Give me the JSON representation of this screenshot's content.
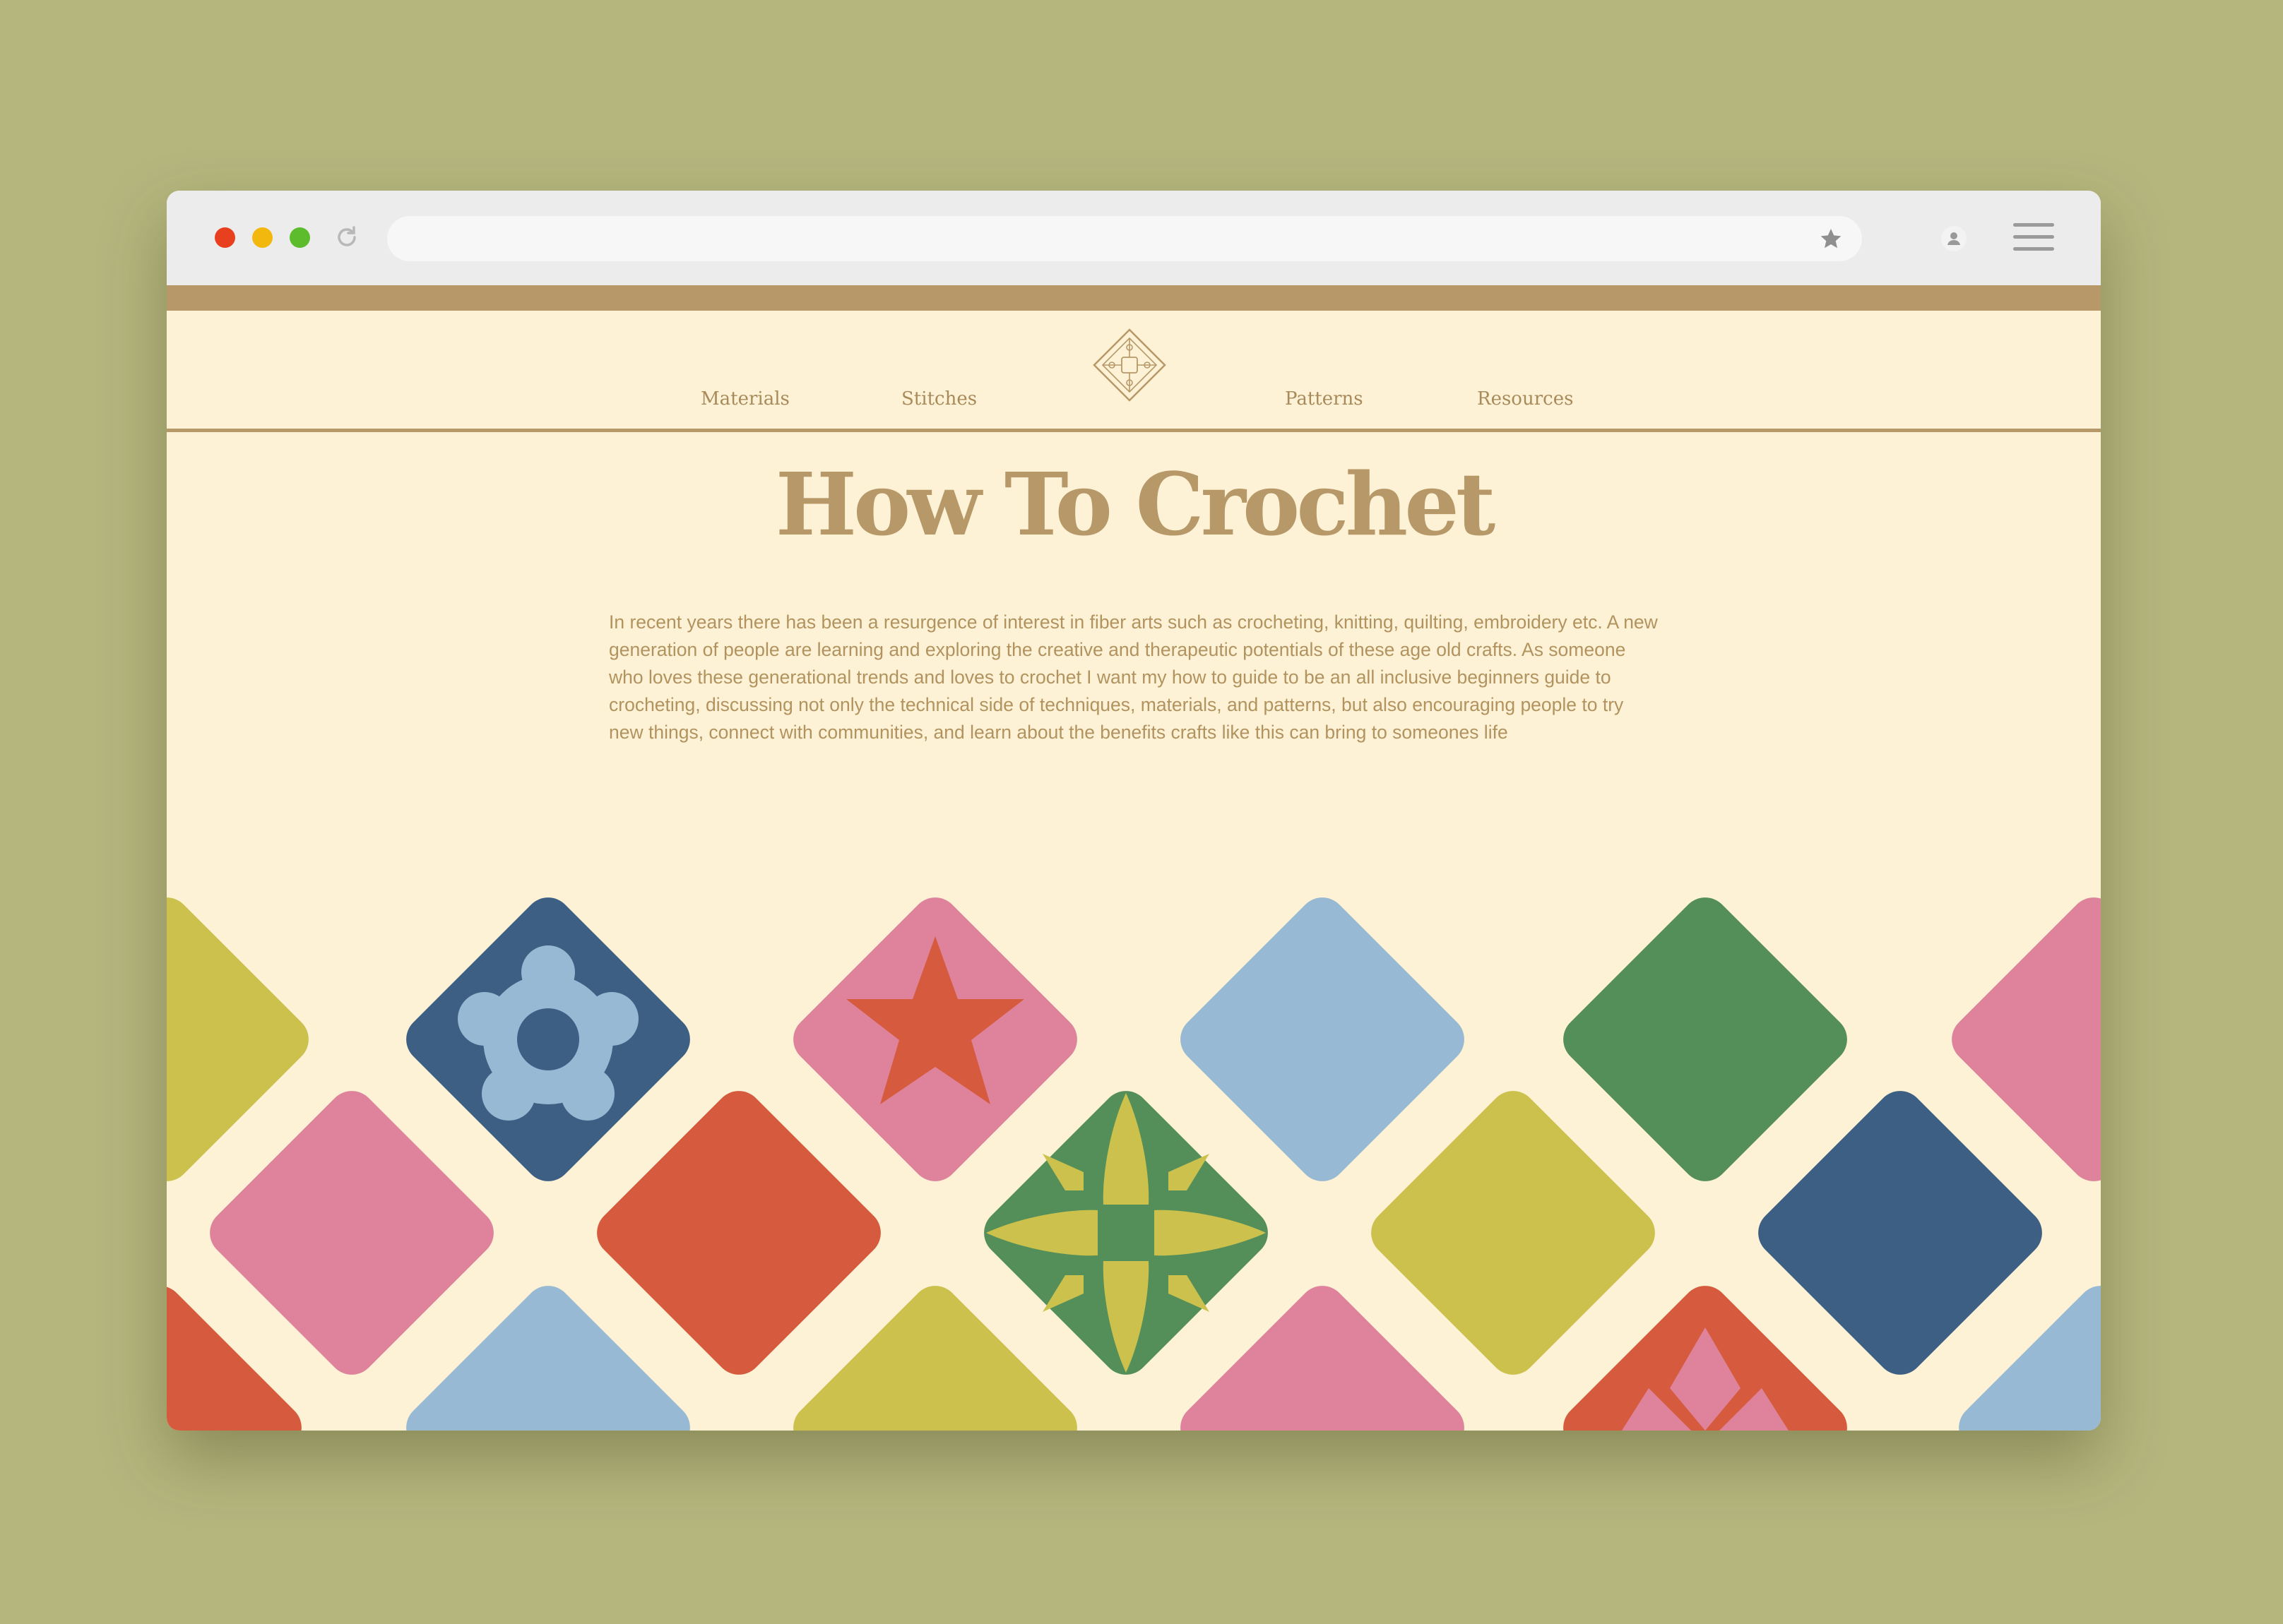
{
  "browser": {
    "window_controls": [
      "close",
      "minimize",
      "maximize"
    ],
    "reload_icon": "reload-icon",
    "address_bar_value": "",
    "bookmark_icon": "star-icon",
    "profile_icon": "user-icon",
    "menu_icon": "hamburger-menu-icon"
  },
  "site": {
    "nav": {
      "items": [
        "Materials",
        "Stitches",
        "Patterns",
        "Resources"
      ],
      "logo_icon": "crochet-granny-square-logo"
    },
    "title": "How To Crochet",
    "intro": "In recent years there has been a resurgence of interest in fiber arts such as crocheting, knitting, quilting, embroidery etc. A new generation of people are learning and exploring the creative and therapeutic potentials of these age old crafts. As someone who loves these generational trends and loves to crochet I want my how to guide to be an all inclusive beginners guide to crocheting, discussing not only the technical side of techniques, materials, and patterns, but also encouraging people to try new things, connect with communities, and learn about the benefits crafts like this can bring to someones life"
  },
  "colors": {
    "backdrop": "#b5b67e",
    "page_bg": "#fdf2d5",
    "accent_tan": "#b79868",
    "tile_yellow": "#cbc14c",
    "tile_pink": "#de839b",
    "tile_navy": "#3d5f84",
    "tile_red": "#d65b3e",
    "tile_lightblue": "#97b9d3",
    "tile_green": "#548f5a"
  },
  "tiles": [
    {
      "color": "tile_yellow",
      "motif": "none"
    },
    {
      "color": "tile_navy",
      "motif": "flower"
    },
    {
      "color": "tile_pink",
      "motif": "star"
    },
    {
      "color": "tile_lightblue",
      "motif": "none"
    },
    {
      "color": "tile_green",
      "motif": "none"
    },
    {
      "color": "tile_pink",
      "motif": "none"
    },
    {
      "color": "tile_pink",
      "motif": "none"
    },
    {
      "color": "tile_red",
      "motif": "none"
    },
    {
      "color": "tile_green",
      "motif": "compass-star"
    },
    {
      "color": "tile_yellow",
      "motif": "none"
    },
    {
      "color": "tile_navy",
      "motif": "none"
    },
    {
      "color": "tile_red",
      "motif": "none"
    },
    {
      "color": "tile_lightblue",
      "motif": "none"
    },
    {
      "color": "tile_yellow",
      "motif": "none"
    },
    {
      "color": "tile_pink",
      "motif": "none"
    },
    {
      "color": "tile_red",
      "motif": "geometric"
    },
    {
      "color": "tile_lightblue",
      "motif": "none"
    }
  ]
}
